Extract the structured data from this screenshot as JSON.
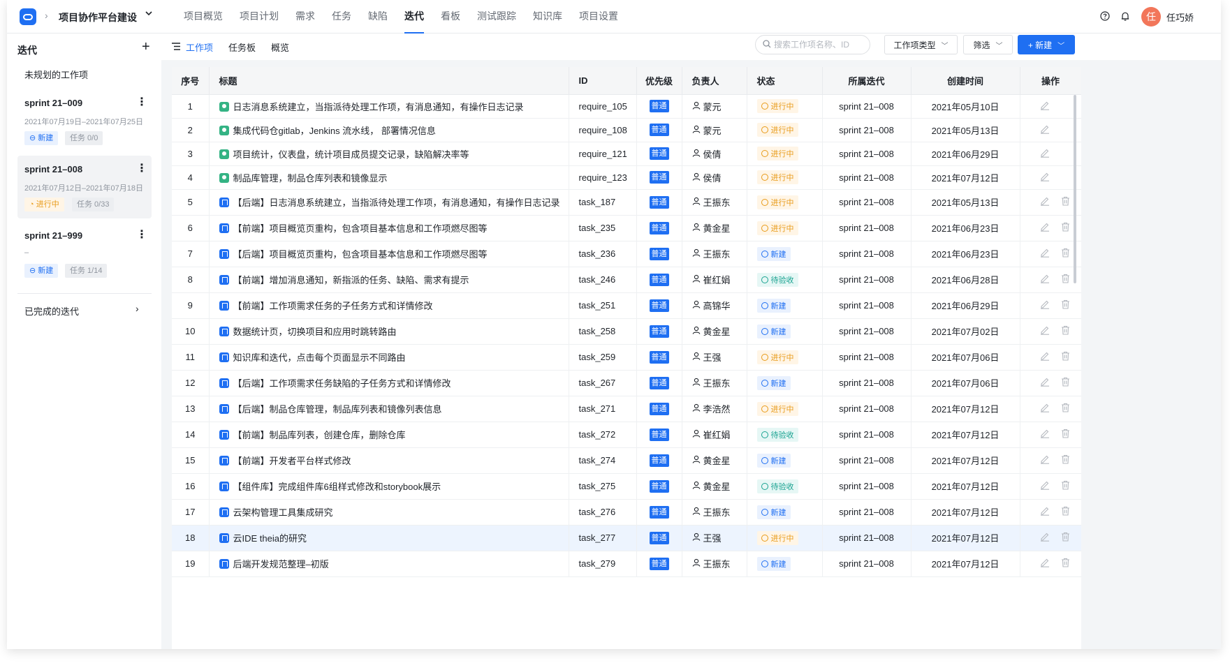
{
  "header": {
    "project_title": "项目协作平台建设",
    "nav": [
      "项目概览",
      "项目计划",
      "需求",
      "任务",
      "缺陷",
      "迭代",
      "看板",
      "测试跟踪",
      "知识库",
      "项目设置"
    ],
    "active_nav": "迭代",
    "user_avatar": "任",
    "user_name": "任巧娇"
  },
  "sidebar": {
    "title": "迭代",
    "unplanned": "未规划的工作项",
    "sprints": [
      {
        "name": "sprint 21–009",
        "dates": "2021年07月19日–2021年07月25日",
        "status": "新建",
        "tasks": "任务 0/0"
      },
      {
        "name": "sprint 21–008",
        "dates": "2021年07月12日–2021年07月18日",
        "status": "进行中",
        "tasks": "任务 0/33"
      },
      {
        "name": "sprint 21–999",
        "dates": "–",
        "status": "新建",
        "tasks": "任务 1/14"
      }
    ],
    "completed": "已完成的迭代"
  },
  "toolbar": {
    "tabs": [
      "工作项",
      "任务板",
      "概览"
    ],
    "search_placeholder": "搜索工作项名称、ID",
    "type_filter": "工作项类型",
    "filter": "筛选",
    "new_button": "+ 新建"
  },
  "table": {
    "columns": [
      "序号",
      "标题",
      "ID",
      "优先级",
      "负责人",
      "状态",
      "所属迭代",
      "创建时间",
      "操作"
    ],
    "rows": [
      {
        "no": "1",
        "type": "req",
        "title": "日志消息系统建立，当指派待处理工作项，有消息通知，有操作日志记录",
        "id": "require_105",
        "priority": "普通",
        "owner": "蒙元",
        "status": "进行中",
        "sprint": "sprint 21–008",
        "created": "2021年05月10日"
      },
      {
        "no": "2",
        "type": "req",
        "title": "集成代码仓gitlab，Jenkins 流水线， 部署情况信息",
        "id": "require_108",
        "priority": "普通",
        "owner": "蒙元",
        "status": "进行中",
        "sprint": "sprint 21–008",
        "created": "2021年05月13日"
      },
      {
        "no": "3",
        "type": "req",
        "title": "项目统计，仪表盘，统计项目成员提交记录，缺陷解决率等",
        "id": "require_121",
        "priority": "普通",
        "owner": "侯倩",
        "status": "进行中",
        "sprint": "sprint 21–008",
        "created": "2021年06月29日"
      },
      {
        "no": "4",
        "type": "req",
        "title": "制品库管理，制品仓库列表和镜像显示",
        "id": "require_123",
        "priority": "普通",
        "owner": "侯倩",
        "status": "进行中",
        "sprint": "sprint 21–008",
        "created": "2021年07月12日"
      },
      {
        "no": "5",
        "type": "task",
        "title": "【后端】日志消息系统建立，当指派待处理工作项，有消息通知，有操作日志记录",
        "id": "task_187",
        "priority": "普通",
        "owner": "王振东",
        "status": "进行中",
        "sprint": "sprint 21–008",
        "created": "2021年05月13日"
      },
      {
        "no": "6",
        "type": "task",
        "title": "【前端】项目概览页重构，包含项目基本信息和工作项燃尽图等",
        "id": "task_235",
        "priority": "普通",
        "owner": "黄金星",
        "status": "进行中",
        "sprint": "sprint 21–008",
        "created": "2021年06月23日"
      },
      {
        "no": "7",
        "type": "task",
        "title": "【后端】项目概览页重构，包含项目基本信息和工作项燃尽图等",
        "id": "task_236",
        "priority": "普通",
        "owner": "王振东",
        "status": "新建",
        "sprint": "sprint 21–008",
        "created": "2021年06月23日"
      },
      {
        "no": "8",
        "type": "task",
        "title": "【前端】增加消息通知，新指派的任务、缺陷、需求有提示",
        "id": "task_246",
        "priority": "普通",
        "owner": "崔红娟",
        "status": "待验收",
        "sprint": "sprint 21–008",
        "created": "2021年06月28日"
      },
      {
        "no": "9",
        "type": "task",
        "title": "【前端】工作项需求任务的子任务方式和详情修改",
        "id": "task_251",
        "priority": "普通",
        "owner": "高锦华",
        "status": "新建",
        "sprint": "sprint 21–008",
        "created": "2021年06月29日"
      },
      {
        "no": "10",
        "type": "task",
        "title": "数据统计页，切换项目和应用时跳转路由",
        "id": "task_258",
        "priority": "普通",
        "owner": "黄金星",
        "status": "新建",
        "sprint": "sprint 21–008",
        "created": "2021年07月02日"
      },
      {
        "no": "11",
        "type": "task",
        "title": "知识库和迭代，点击每个页面显示不同路由",
        "id": "task_259",
        "priority": "普通",
        "owner": "王强",
        "status": "进行中",
        "sprint": "sprint 21–008",
        "created": "2021年07月06日"
      },
      {
        "no": "12",
        "type": "task",
        "title": "【后端】工作项需求任务缺陷的子任务方式和详情修改",
        "id": "task_267",
        "priority": "普通",
        "owner": "王振东",
        "status": "新建",
        "sprint": "sprint 21–008",
        "created": "2021年07月06日"
      },
      {
        "no": "13",
        "type": "task",
        "title": "【后端】制品仓库管理，制品库列表和镜像列表信息",
        "id": "task_271",
        "priority": "普通",
        "owner": "李浩然",
        "status": "进行中",
        "sprint": "sprint 21–008",
        "created": "2021年07月12日"
      },
      {
        "no": "14",
        "type": "task",
        "title": "【前端】制品库列表，创建仓库，删除仓库",
        "id": "task_272",
        "priority": "普通",
        "owner": "崔红娟",
        "status": "待验收",
        "sprint": "sprint 21–008",
        "created": "2021年07月12日"
      },
      {
        "no": "15",
        "type": "task",
        "title": "【前端】开发者平台样式修改",
        "id": "task_274",
        "priority": "普通",
        "owner": "黄金星",
        "status": "新建",
        "sprint": "sprint 21–008",
        "created": "2021年07月12日"
      },
      {
        "no": "16",
        "type": "task",
        "title": "【组件库】完成组件库6组样式修改和storybook展示",
        "id": "task_275",
        "priority": "普通",
        "owner": "黄金星",
        "status": "待验收",
        "sprint": "sprint 21–008",
        "created": "2021年07月12日"
      },
      {
        "no": "17",
        "type": "task",
        "title": "云架构管理工具集成研究",
        "id": "task_276",
        "priority": "普通",
        "owner": "王振东",
        "status": "新建",
        "sprint": "sprint 21–008",
        "created": "2021年07月12日"
      },
      {
        "no": "18",
        "type": "task",
        "title": "云IDE theia的研究",
        "id": "task_277",
        "priority": "普通",
        "owner": "王强",
        "status": "进行中",
        "sprint": "sprint 21–008",
        "created": "2021年07月12日",
        "selected": true
      },
      {
        "no": "19",
        "type": "task",
        "title": "后端开发规范整理–初版",
        "id": "task_279",
        "priority": "普通",
        "owner": "王振东",
        "status": "新建",
        "sprint": "sprint 21–008",
        "created": "2021年07月12日"
      }
    ]
  },
  "colors": {
    "accent": "#1f6ff2",
    "in_progress": "#e89b19",
    "new": "#1f6ff2",
    "acceptance": "#1aa391",
    "requirement_icon": "#34b384"
  }
}
